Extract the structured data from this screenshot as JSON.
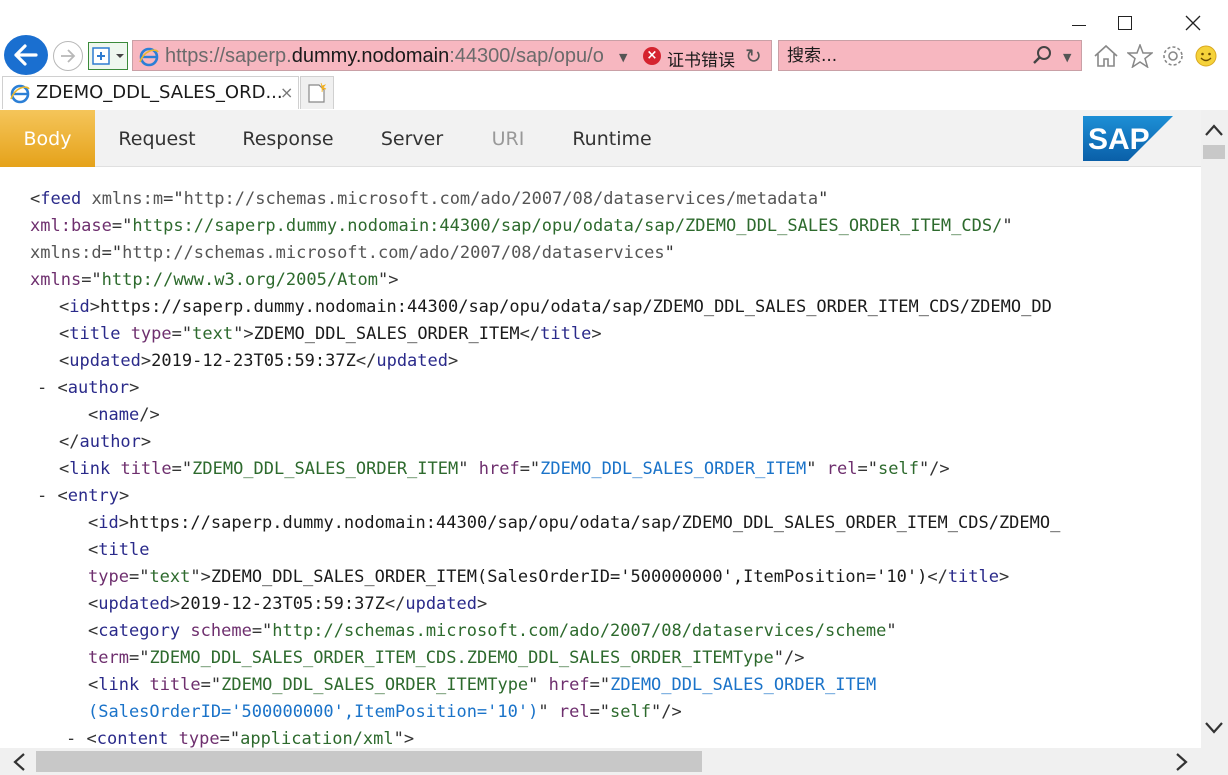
{
  "window": {
    "minimize": "minimize",
    "maximize": "maximize",
    "close": "close"
  },
  "toolbar": {
    "address_url_scheme": "https://saperp.",
    "address_url_host": "dummy.nodomain",
    "address_url_rest": ":44300/sap/opu/o",
    "cert_error": "证书错误",
    "search_placeholder": "搜索..."
  },
  "tab": {
    "title": "ZDEMO_DDL_SALES_ORD...",
    "close": "×"
  },
  "sap_menu": {
    "items": [
      "Body",
      "Request",
      "Response",
      "Server",
      "URI",
      "Runtime"
    ],
    "active": "Body",
    "disabled": [
      "URI"
    ],
    "logo_text": "SAP"
  },
  "xml": {
    "feed_open": "feed",
    "metadata_ns_attr": "xmlns:m",
    "metadata_ns_value": "http://schemas.microsoft.com/ado/2007/08/dataservices/metadata",
    "xmlbase_attr": "xml:base",
    "xmlbase_value": "https://saperp.dummy.nodomain:44300/sap/opu/odata/sap/ZDEMO_DDL_SALES_ORDER_ITEM_CDS/",
    "d_ns_attr": "xmlns:d",
    "d_ns_value": "http://schemas.microsoft.com/ado/2007/08/dataservices",
    "xmlns_attr": "xmlns",
    "xmlns_value": "http://www.w3.org/2005/Atom",
    "feed_id": "https://saperp.dummy.nodomain:44300/sap/opu/odata/sap/ZDEMO_DDL_SALES_ORDER_ITEM_CDS/ZDEMO_DD",
    "feed_title_type": "text",
    "feed_title": "ZDEMO_DDL_SALES_ORDER_ITEM",
    "feed_updated": "2019-12-23T05:59:37Z",
    "link_title": "ZDEMO_DDL_SALES_ORDER_ITEM",
    "link_href": "ZDEMO_DDL_SALES_ORDER_ITEM",
    "link_rel": "self",
    "entry_id": "https://saperp.dummy.nodomain:44300/sap/opu/odata/sap/ZDEMO_DDL_SALES_ORDER_ITEM_CDS/ZDEMO_",
    "entry_title_type": "text",
    "entry_title": "ZDEMO_DDL_SALES_ORDER_ITEM(SalesOrderID='500000000',ItemPosition='10')",
    "entry_updated": "2019-12-23T05:59:37Z",
    "category_scheme": "http://schemas.microsoft.com/ado/2007/08/dataservices/scheme",
    "category_term": "ZDEMO_DDL_SALES_ORDER_ITEM_CDS.ZDEMO_DDL_SALES_ORDER_ITEMType",
    "entry_link_title": "ZDEMO_DDL_SALES_ORDER_ITEMType",
    "entry_link_href_1": "ZDEMO_DDL_SALES_ORDER_ITEM",
    "entry_link_href_2": "(SalesOrderID='500000000',ItemPosition='10')",
    "entry_link_rel": "self",
    "content_type": "application/xml"
  }
}
